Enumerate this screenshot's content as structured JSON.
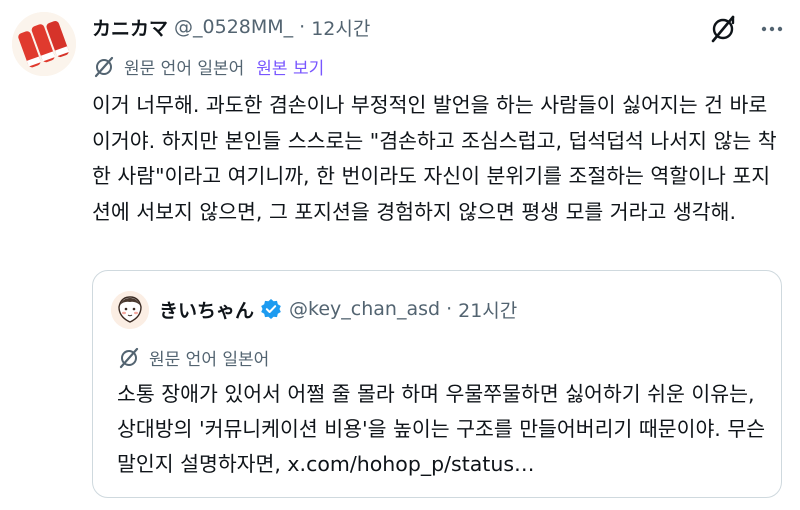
{
  "post": {
    "display_name": "カニカマ",
    "handle": "@_0528MM_",
    "separator": "·",
    "time": "12시간",
    "translation_note": "원문 언어 일본어",
    "show_original": "원본 보기",
    "text": "이거 너무해. 과도한 겸손이나 부정적인 발언을 하는 사람들이 싫어지는 건 바로 이거야. 하지만 본인들 스스로는 \"겸손하고 조심스럽고, 덥석덥석 나서지 않는 착한 사람\"이라고 여기니까, 한 번이라도 자신이 분위기를 조절하는 역할이나 포지션에 서보지 않으면, 그 포지션을 경험하지 않으면 평생 모를 거라고 생각해."
  },
  "quote": {
    "display_name": "きいちゃん",
    "handle": "@key_chan_asd",
    "separator": "·",
    "time": "21시간",
    "translation_note": "원문 언어 일본어",
    "text": "소통 장애가 있어서 어쩔 줄 몰라 하며 우물쭈물하면 싫어하기 쉬운 이유는, 상대방의 '커뮤니케이션 비용'을 높이는 구조를 만들어버리기 때문이야. 무슨 말인지 설명하자면, x.com/hohop_p/status…"
  },
  "icons": {
    "avatar": "crab-stick-avatar",
    "grok": "grok-icon",
    "more": "more-icon",
    "globe": "globe-icon",
    "verified": "verified-badge-icon",
    "quote_avatar": "cartoon-face-avatar"
  },
  "colors": {
    "text": "#0f1419",
    "secondary": "#536471",
    "link": "#7856ff",
    "verified": "#1d9bf0",
    "border": "#cfd9de",
    "avatar_red": "#e03a2e"
  }
}
